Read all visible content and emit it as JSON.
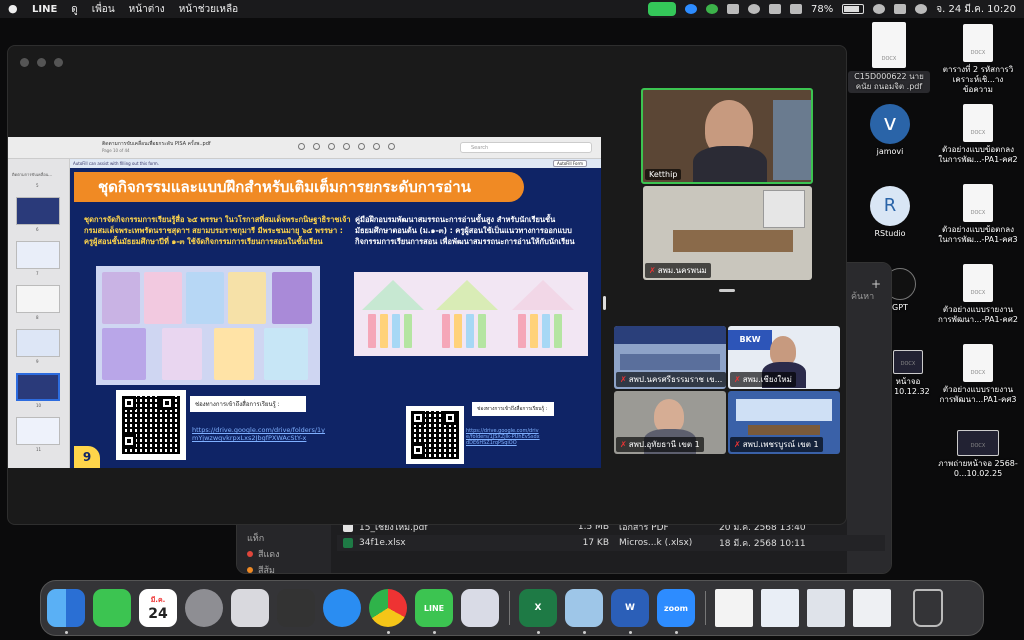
{
  "menubar": {
    "app_name": "LINE",
    "menus": [
      "ดู",
      "เพื่อน",
      "หน้าต่าง",
      "หน้าช่วยเหลือ"
    ],
    "battery": "78%",
    "datetime": "จ. 24 มี.ค.  10:20"
  },
  "preview": {
    "doc_title": "ติดตามการขับเคลื่อนเพื่อยกระดับ PISA ครั้งพ..pdf",
    "page_info": "Page 10 of 44",
    "search_placeholder": "Search",
    "autofill_msg": "AutoFill can assist with filling out this form.",
    "autofill_button": "AutoFill Form",
    "sidebar_label": "ติดตามการขับเคลื่อน...",
    "thumb_numbers": [
      "5",
      "6",
      "7",
      "8",
      "9",
      "10",
      "11"
    ]
  },
  "slide": {
    "header": "ชุดกิจกรรมและแบบฝึกสำหรับเติมเต็มการยกระดับการอ่าน",
    "left_text": "ชุดการจัดกิจกรรมการเรียนรู้สื่อ ๖๕ พรรษา ในวโรกาสที่สมเด็จพระกนิษฐาธิราชเจ้า กรมสมเด็จพระเทพรัตนราชสุดาฯ สยามบรมราชกุมารี มีพระชนมายุ ๖๕ พรรษา : ครูผู้สอนชั้นมัธยมศึกษาปีที่ ๑-๓ ใช้จัดกิจกรรมการเรียนการสอนในชั้นเรียน",
    "right_text": "คู่มือฝึกอบรมพัฒนาสมรรถนะการอ่านขั้นสูง สำหรับนักเรียนชั้นมัธยมศึกษาตอนต้น (ม.๑-๓) : ครูผู้สอนใช้เป็นแนวทางการออกแบบกิจกรรมการเรียนการสอน เพื่อพัฒนาสมรรถนะการอ่านให้กับนักเรียน",
    "left_link_label": "ช่องทางการเข้าถึงสื่อการเรียนรู้ :",
    "left_link": "https://drive.google.com/drive/folders/1ymYjwzwqvkrpxLxs2JbgfPXWAcStY-x",
    "right_link_label": "ช่องทางการเข้าถึงสื่อการเรียนรู้ :",
    "right_link": "https://drive.google.com/drive/folders/1JSXZjlk-PUhEvSsdxdDE6HSZ1rqPSqiOO",
    "page_badge": "9"
  },
  "participants": [
    {
      "name": "Ketthip",
      "muted": false,
      "active": true
    },
    {
      "name": "สพม.นครพนม",
      "muted": true,
      "active": false
    },
    {
      "name": "สพป.นครศรีธรรมราช เข...",
      "muted": true,
      "active": false
    },
    {
      "name": "สพม.เชียงใหม่",
      "muted": true,
      "active": false
    },
    {
      "name": "สพป.อุทัยธานี เขต 1",
      "muted": true,
      "active": false
    },
    {
      "name": "สพป.เพชรบูรณ์ เขต 1",
      "muted": true,
      "active": false
    }
  ],
  "tile_text": {
    "bkw": "BKW"
  },
  "finder": {
    "search_label": "ค้นหา",
    "sidebar": [
      {
        "label": "แท็ก",
        "color": ""
      },
      {
        "label": "สีแดง",
        "color": "#e0463b"
      },
      {
        "label": "สีส้ม",
        "color": "#f08a24"
      }
    ],
    "files": [
      {
        "name": "15_เชียงใหม่.pdf",
        "size": "1.5 MB",
        "kind": "เอกสาร PDF",
        "date": "20 มี.ค. 2568 13:40"
      },
      {
        "name": "34f1e.xlsx",
        "size": "17 KB",
        "kind": "Micros...k (.xlsx)",
        "date": "18 มี.ค. 2568 10:11"
      }
    ]
  },
  "desktop": {
    "selected_file": "C15D000622 นายคนัย ถนอมจิต .pdf",
    "icons": [
      {
        "label": "ตารางที่ 2 รหัสการวิเคราะห์เชิ...างข้อความ"
      },
      {
        "label": "ตัวอย่างแบบข้อตกลงในการพัฒ...-PA1-คศ2"
      },
      {
        "label": "ตัวอย่างแบบข้อตกลงในการพัฒ...-PA1-คศ3"
      },
      {
        "label": "ตัวอย่างแบบรายงานการพัฒนา...-PA1-คศ2"
      },
      {
        "label": "ตัวอย่างแบบรายงานการพัฒนา...PA1-คศ3"
      },
      {
        "label": "ภาพถ่ายหน้าจอ 2568-0...10.02.25"
      }
    ],
    "apps": [
      {
        "label": "jamovi",
        "glyph": "v"
      },
      {
        "label": "RStudio",
        "glyph": "R"
      },
      {
        "label": "GPT"
      }
    ],
    "partial_labels": [
      "หน้าจอ",
      "ที่ 10.12.32"
    ]
  },
  "dock": {
    "calendar_month": "มี.ค.",
    "calendar_day": "24",
    "line_label": "LINE",
    "zoom_label": "zoom",
    "word_label": "W",
    "excel_label": "X"
  },
  "colors": {
    "slide_bg": "#0f2466",
    "header_orange": "#f08a24",
    "active_border": "#3cc451",
    "accent_yellow": "#ffd54a"
  }
}
